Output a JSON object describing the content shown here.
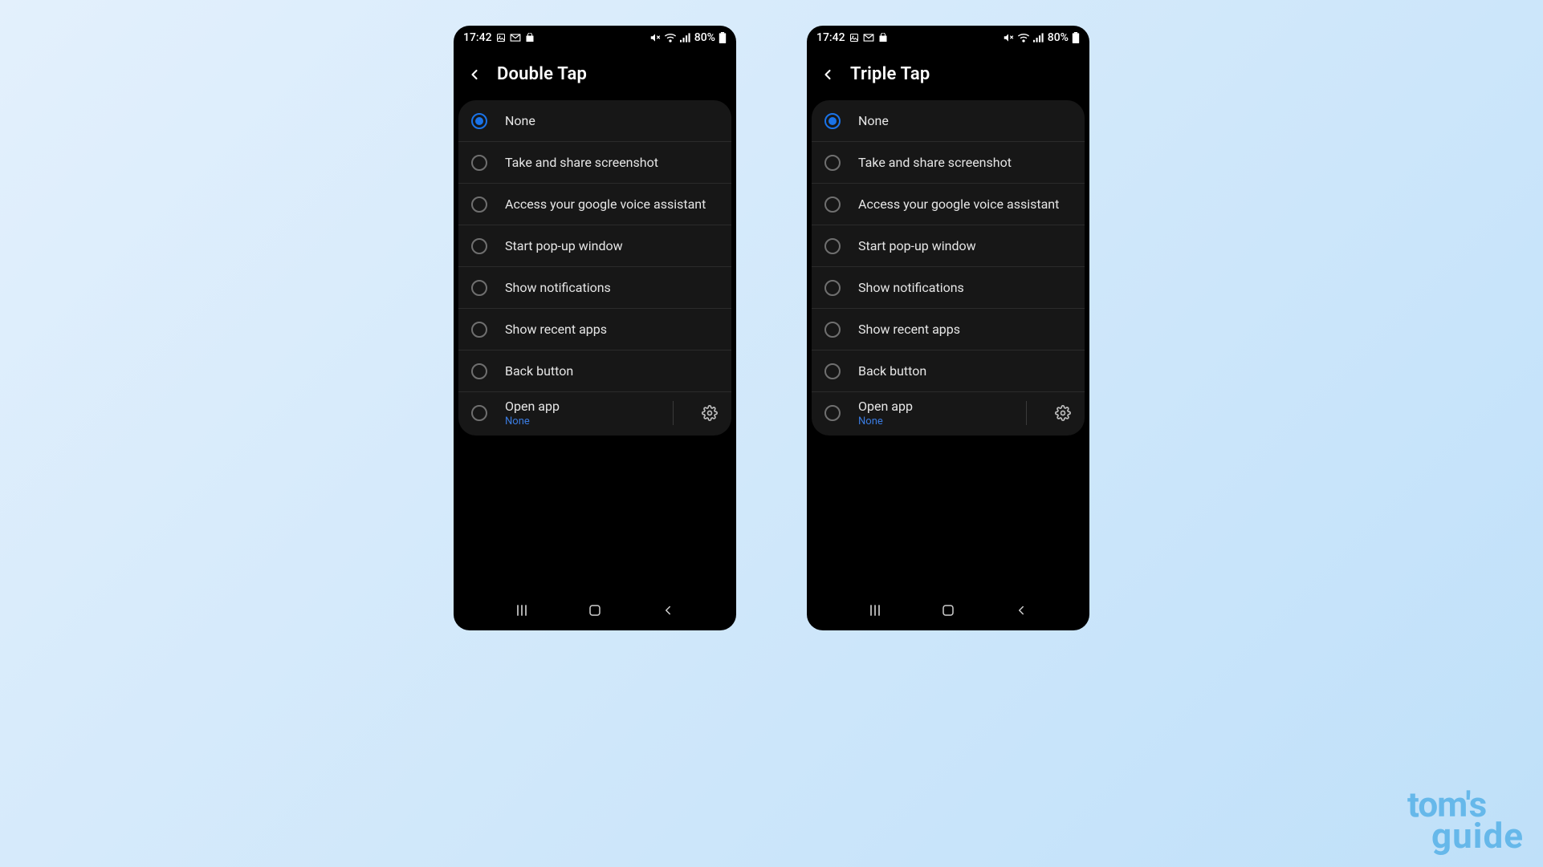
{
  "statusbar": {
    "time": "17:42",
    "battery": "80%"
  },
  "screens": [
    {
      "title": "Double Tap"
    },
    {
      "title": "Triple Tap"
    }
  ],
  "options": [
    {
      "label": "None",
      "selected": true
    },
    {
      "label": "Take and share screenshot",
      "selected": false
    },
    {
      "label": "Access your google voice assistant",
      "selected": false
    },
    {
      "label": "Start pop-up window",
      "selected": false
    },
    {
      "label": "Show notifications",
      "selected": false
    },
    {
      "label": "Show recent apps",
      "selected": false
    },
    {
      "label": "Back button",
      "selected": false
    }
  ],
  "open_app": {
    "label": "Open app",
    "sub": "None"
  },
  "watermark": {
    "line1": "tom's",
    "line2": "guide"
  }
}
